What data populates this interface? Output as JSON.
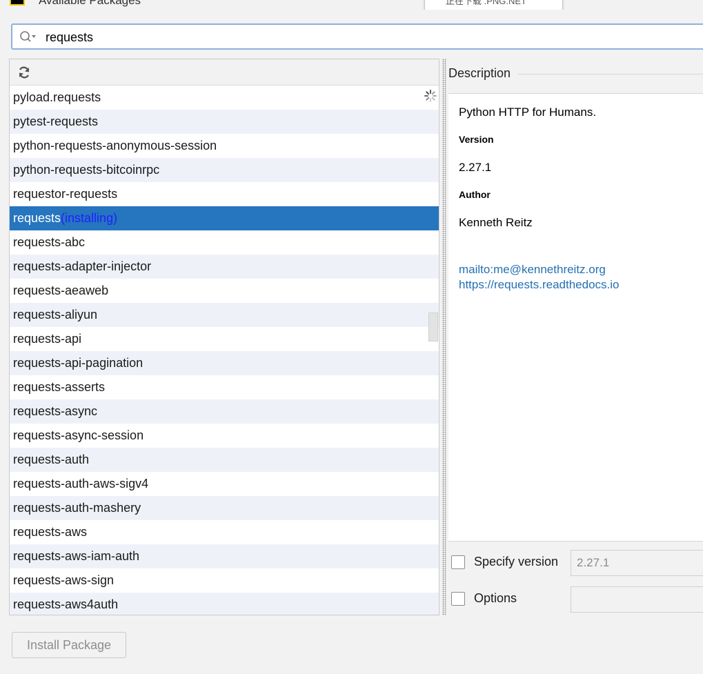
{
  "window": {
    "title": "Available Packages",
    "popup_text": "正在下载 .PNG.NET"
  },
  "search": {
    "value": "requests",
    "icon": "search-icon"
  },
  "package_list": {
    "refresh_icon": "refresh-icon",
    "items": [
      {
        "name": "pyload.requests"
      },
      {
        "name": "pytest-requests"
      },
      {
        "name": "python-requests-anonymous-session"
      },
      {
        "name": "python-requests-bitcoinrpc"
      },
      {
        "name": "requestor-requests"
      },
      {
        "name": "requests",
        "status": "(installing)",
        "selected": true
      },
      {
        "name": "requests-abc"
      },
      {
        "name": "requests-adapter-injector"
      },
      {
        "name": "requests-aeaweb"
      },
      {
        "name": "requests-aliyun"
      },
      {
        "name": "requests-api"
      },
      {
        "name": "requests-api-pagination"
      },
      {
        "name": "requests-asserts"
      },
      {
        "name": "requests-async"
      },
      {
        "name": "requests-async-session"
      },
      {
        "name": "requests-auth"
      },
      {
        "name": "requests-auth-aws-sigv4"
      },
      {
        "name": "requests-auth-mashery"
      },
      {
        "name": "requests-aws"
      },
      {
        "name": "requests-aws-iam-auth"
      },
      {
        "name": "requests-aws-sign"
      },
      {
        "name": "requests-aws4auth"
      }
    ]
  },
  "description": {
    "header": "Description",
    "summary": "Python HTTP for Humans.",
    "version_label": "Version",
    "version": "2.27.1",
    "author_label": "Author",
    "author": "Kenneth Reitz",
    "links": [
      "mailto:me@kennethreitz.org",
      "https://requests.readthedocs.io"
    ]
  },
  "options": {
    "specify_version_label": "Specify version",
    "specify_version_value": "2.27.1",
    "options_label": "Options",
    "options_value": ""
  },
  "buttons": {
    "install": "Install Package"
  },
  "colors": {
    "selection": "#2675bf",
    "status_text": "#2020ff",
    "link": "#2470b3",
    "search_border": "#8ab1dd"
  }
}
